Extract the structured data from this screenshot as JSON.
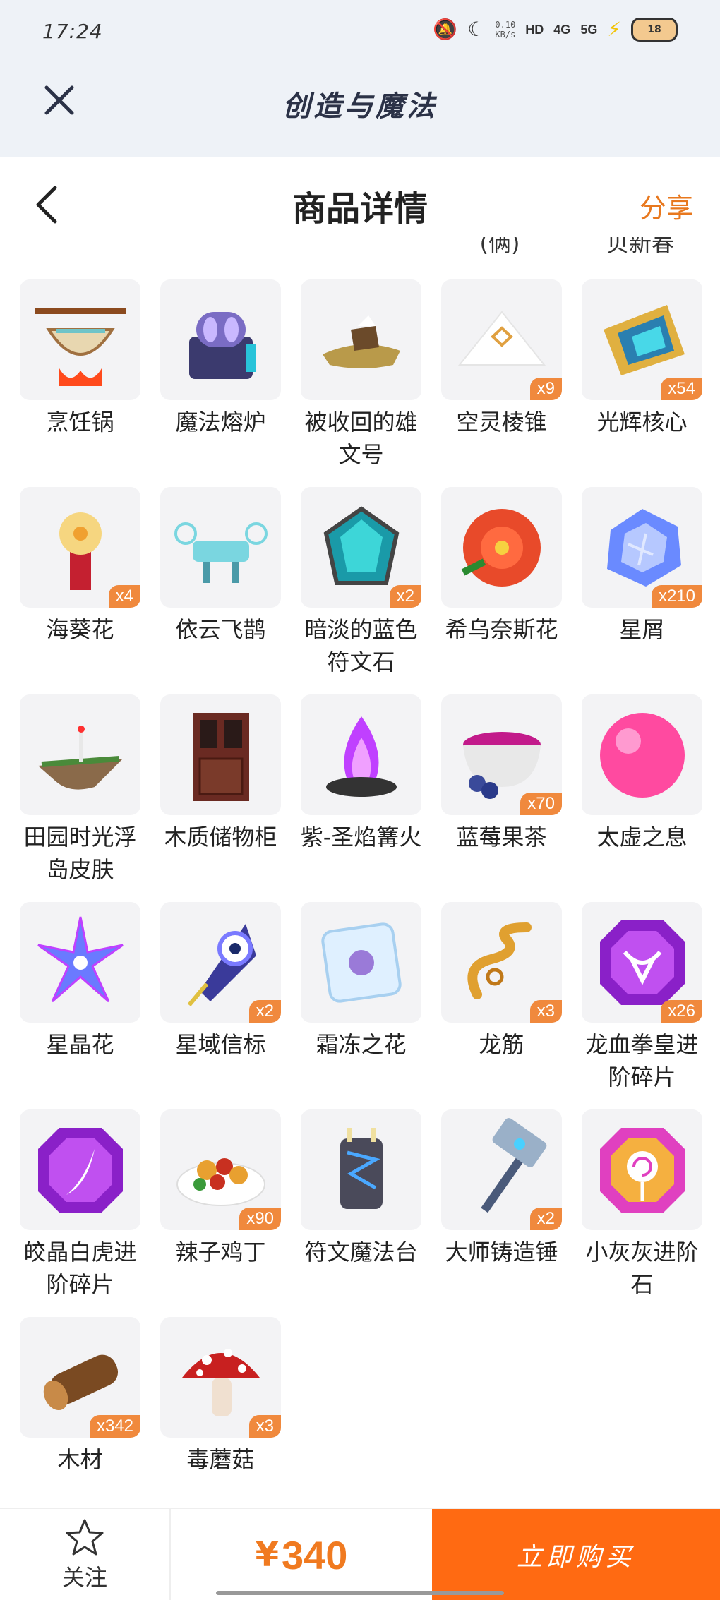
{
  "status_bar": {
    "time": "17:24",
    "net_speed_value": "0.10",
    "net_speed_unit": "KB/s",
    "hd_label": "HD",
    "signal1": "4G",
    "signal2": "5G",
    "battery": "18"
  },
  "app": {
    "title": "创造与魔法"
  },
  "header": {
    "title": "商品详情",
    "share_label": "分享"
  },
  "clipped_labels": [
    "(俩)",
    "贝新春"
  ],
  "items": [
    {
      "name": "烹饪锅",
      "qty": "",
      "icon": "cooking-pot"
    },
    {
      "name": "魔法熔炉",
      "qty": "",
      "icon": "magic-furnace"
    },
    {
      "name": "被收回的雄文号",
      "qty": "",
      "icon": "wrecked-ship"
    },
    {
      "name": "空灵棱锥",
      "qty": "x9",
      "icon": "white-pyramid"
    },
    {
      "name": "光辉核心",
      "qty": "x54",
      "icon": "radiant-core"
    },
    {
      "name": "海葵花",
      "qty": "x4",
      "icon": "anemone-flower"
    },
    {
      "name": "依云飞鹊",
      "qty": "",
      "icon": "flying-machine"
    },
    {
      "name": "暗淡的蓝色符文石",
      "qty": "x2",
      "icon": "blue-rune-stone"
    },
    {
      "name": "希乌奈斯花",
      "qty": "",
      "icon": "red-flower"
    },
    {
      "name": "星屑",
      "qty": "x210",
      "icon": "stardust"
    },
    {
      "name": "田园时光浮岛皮肤",
      "qty": "",
      "icon": "floating-island"
    },
    {
      "name": "木质储物柜",
      "qty": "",
      "icon": "wooden-cabinet"
    },
    {
      "name": "紫-圣焰篝火",
      "qty": "",
      "icon": "purple-bonfire"
    },
    {
      "name": "蓝莓果茶",
      "qty": "x70",
      "icon": "blueberry-tea"
    },
    {
      "name": "太虚之息",
      "qty": "",
      "icon": "pink-orb"
    },
    {
      "name": "星晶花",
      "qty": "",
      "icon": "star-crystal"
    },
    {
      "name": "星域信标",
      "qty": "x2",
      "icon": "star-beacon"
    },
    {
      "name": "霜冻之花",
      "qty": "",
      "icon": "frost-flower"
    },
    {
      "name": "龙筋",
      "qty": "x3",
      "icon": "dragon-tendon"
    },
    {
      "name": "龙血拳皇进阶碎片",
      "qty": "x26",
      "icon": "purple-bull-shard"
    },
    {
      "name": "皎晶白虎进阶碎片",
      "qty": "",
      "icon": "purple-claw-shard"
    },
    {
      "name": "辣子鸡丁",
      "qty": "x90",
      "icon": "spicy-chicken"
    },
    {
      "name": "符文魔法台",
      "qty": "",
      "icon": "rune-altar"
    },
    {
      "name": "大师铸造锤",
      "qty": "x2",
      "icon": "forge-hammer"
    },
    {
      "name": "小灰灰进阶石",
      "qty": "",
      "icon": "lollipop-stone"
    },
    {
      "name": "木材",
      "qty": "x342",
      "icon": "wood-log"
    },
    {
      "name": "毒蘑菇",
      "qty": "x3",
      "icon": "poison-mushroom"
    }
  ],
  "bottom": {
    "follow_label": "关注",
    "currency": "¥",
    "price": "340",
    "buy_label": "立即购买"
  },
  "colors": {
    "accent": "#f07a20",
    "buy_bg": "#ff6a12",
    "badge": "#f0893d"
  }
}
